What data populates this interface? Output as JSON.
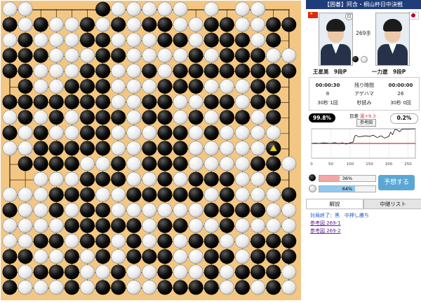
{
  "match": {
    "title": "【囲碁】阿含・桐山杯日中決戦",
    "move_number": "269手",
    "last_move": {
      "col": 17,
      "row": 9,
      "color": "white"
    }
  },
  "players": {
    "left": {
      "name": "王星昊",
      "rank": "9段P",
      "name_full": "王星昊　9段P",
      "color": "black",
      "flag": "CN"
    },
    "right": {
      "name": "一力遼",
      "rank": "9段P",
      "name_full": "一力遼　9段P",
      "color": "white",
      "flag": "JP"
    }
  },
  "stats": {
    "rows": [
      {
        "left": "00:00:30",
        "label": "残り時間",
        "right": "00:00:00"
      },
      {
        "left": "8",
        "label": "アゲハマ",
        "right": "26"
      },
      {
        "left": "30秒 1回",
        "label": "秒読み",
        "right": "30秒 0回"
      }
    ]
  },
  "winrate": {
    "black_pct": "99.8%",
    "white_pct": "0.2%",
    "margin_label": "目差",
    "margin_value": "黒+9.3",
    "reference_button": "参考図"
  },
  "prediction": {
    "black_pct_label": "36%",
    "white_pct_label": "64%",
    "black_value": 0.36,
    "white_value": 0.64,
    "button": "予想する"
  },
  "tabs": [
    "解説",
    "中継リスト"
  ],
  "commentary": {
    "result": "対局終了：黒　中押し勝ち",
    "links": [
      "参考図 269-1",
      "参考図 269-2"
    ]
  },
  "colors": {
    "black_bar": "#f4a6a6",
    "white_bar": "#8fc8f0",
    "title_bar": "#1f3d7a",
    "predict_button": "#5aa7d6",
    "board_wood": "#f3c783",
    "line_red": "#cc0000"
  },
  "board": {
    "size": 19,
    "rows": [
      "WW....BWWWWW.W.WW..",
      "BWBWWBWBWBBWWBBWWBB",
      "WBWWWBBWWWBBWBBBWB.",
      "BBBWWWBBWWWWBWBBBWW",
      "BBWWWBBWWBWBBBBBBBB",
      ".BWWBBBWWWBBBWWWBB.",
      "BBBBBBBWWBBWWBBWBB.",
      "WBWBWBBBWBBWBWBBWB.",
      "BWBWWBBWWWBBWBWWWW.",
      "WWBBBBBWWBBBWWWWWW.",
      ".BBBBWWBWBBBWWWWBBW",
      "..WWWBBBWWBWBBBWWB.",
      "WWWBBBWWBBBBBWBWWWB",
      "BWWBWBBWWWWWWBBBBWW",
      "WWWWBBBBBWBBWWBWWWW",
      "WWBBWBBWBWBWBBWWBBB",
      "BBWWBWBWBBBWWBBWBBB",
      "BWBBBWWBWWBWWBWBBBW",
      "BWWWBWBBWWBBBBWBWBW"
    ]
  },
  "graph": {
    "x_ticks": [
      "0",
      "50",
      "100",
      "150",
      "200",
      "250"
    ],
    "x_max": 269,
    "center_line": 50,
    "winrate_series": [
      [
        0,
        50
      ],
      [
        10,
        51
      ],
      [
        20,
        50
      ],
      [
        30,
        52
      ],
      [
        40,
        51
      ],
      [
        50,
        50
      ],
      [
        60,
        53
      ],
      [
        70,
        49
      ],
      [
        80,
        52
      ],
      [
        90,
        48
      ],
      [
        100,
        52
      ],
      [
        108,
        55
      ],
      [
        112,
        75
      ],
      [
        116,
        78
      ],
      [
        122,
        72
      ],
      [
        130,
        74
      ],
      [
        140,
        76
      ],
      [
        150,
        74
      ],
      [
        160,
        78
      ],
      [
        170,
        70
      ],
      [
        180,
        76
      ],
      [
        190,
        68
      ],
      [
        200,
        74
      ],
      [
        205,
        88
      ],
      [
        210,
        80
      ],
      [
        216,
        98
      ],
      [
        222,
        96
      ],
      [
        228,
        90
      ],
      [
        234,
        98
      ],
      [
        240,
        99
      ],
      [
        250,
        99
      ],
      [
        260,
        99.5
      ],
      [
        269,
        99.8
      ]
    ]
  }
}
